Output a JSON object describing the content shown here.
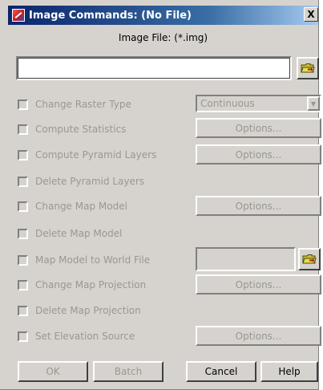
{
  "window": {
    "title": "Image Commands: (No File)",
    "close_glyph": "X"
  },
  "file": {
    "label": "Image File: (*.img)",
    "value": ""
  },
  "commands": [
    {
      "label": "Change Raster Type"
    },
    {
      "label": "Compute Statistics"
    },
    {
      "label": "Compute Pyramid Layers"
    },
    {
      "label": "Delete Pyramid Layers"
    },
    {
      "label": "Change Map Model"
    },
    {
      "label": "Delete Map Model"
    },
    {
      "label": "Map Model to World File"
    },
    {
      "label": "Change Map Projection"
    },
    {
      "label": "Delete Map Projection"
    },
    {
      "label": "Set Elevation Source"
    }
  ],
  "raster_type": {
    "selected": "Continuous",
    "arrow": "▼"
  },
  "options_label": "Options...",
  "world_file": {
    "value": ""
  },
  "buttons": {
    "ok": "OK",
    "batch": "Batch",
    "cancel": "Cancel",
    "help": "Help"
  },
  "icons": {
    "title": "imagine-app-icon",
    "folder": "open-folder-icon"
  },
  "colors": {
    "title_bar_start": "#0a246a",
    "title_bar_end": "#a6caf0",
    "dialog_face": "#d6d3ce",
    "disabled_text": "#9a9791"
  }
}
